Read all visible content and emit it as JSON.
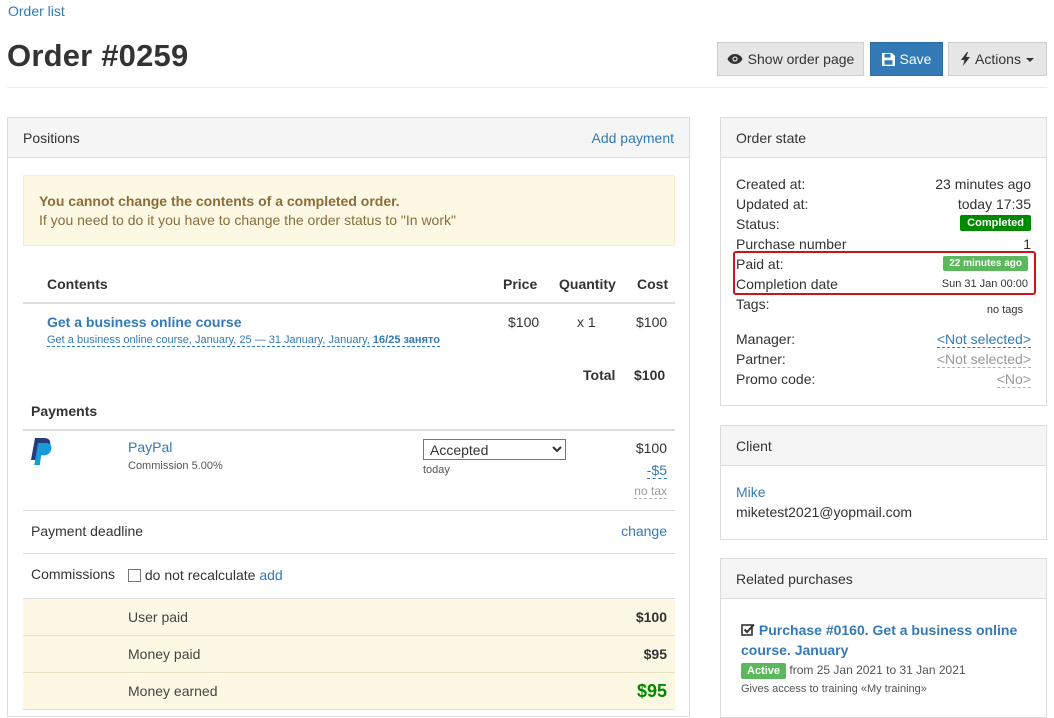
{
  "breadcrumb": {
    "order_list": "Order list"
  },
  "page_title": "Order #0259",
  "toolbar": {
    "show_order_page": "Show order page",
    "save": "Save",
    "actions": "Actions"
  },
  "positions": {
    "title": "Positions",
    "add_payment": "Add payment",
    "warning_title": "You cannot change the contents of a completed order.",
    "warning_text": "If you need to do it you have to change the order status to \"In work\"",
    "headers": {
      "contents": "Contents",
      "price": "Price",
      "quantity": "Quantity",
      "cost": "Cost"
    },
    "item": {
      "name": "Get a business online course",
      "sub": "Get a business online course, January, 25 — 31 January, January, ",
      "seats": "16/25 занято",
      "price": "$100",
      "quantity": "x 1",
      "cost": "$100"
    },
    "total_label": "Total",
    "total_value": "$100",
    "payments_title": "Payments",
    "payment": {
      "method": "PayPal",
      "commission": "Commission 5.00%",
      "status_selected": "Accepted",
      "date": "today",
      "amount": "$100",
      "fee": "-$5",
      "tax": "no tax"
    },
    "deadline_label": "Payment deadline",
    "deadline_action": "change",
    "commissions_label": "Commissions",
    "do_not_recalculate": "do not recalculate",
    "add": "add",
    "summary": [
      {
        "label": "User paid",
        "value": "$100"
      },
      {
        "label": "Money paid",
        "value": "$95"
      },
      {
        "label": "Money earned",
        "value": "$95"
      }
    ]
  },
  "order_state": {
    "title": "Order state",
    "created_label": "Created at:",
    "created_value": "23 minutes ago",
    "updated_label": "Updated at:",
    "updated_value": "today 17:35",
    "status_label": "Status:",
    "status_value": "Completed",
    "purchase_label": "Purchase number",
    "purchase_value": "1",
    "paid_label": "Paid at:",
    "paid_value": "22 minutes ago",
    "completion_label": "Completion date",
    "completion_value": "Sun 31 Jan 00:00",
    "tags_label": "Tags:",
    "tags_value": "no tags",
    "manager_label": "Manager:",
    "manager_value": "<Not selected>",
    "partner_label": "Partner:",
    "partner_value": "<Not selected>",
    "promo_label": "Promo code:",
    "promo_value": "<No>"
  },
  "client": {
    "title": "Client",
    "name": "Mike",
    "email": "miketest2021@yopmail.com"
  },
  "related": {
    "title": "Related purchases",
    "purchase_link": "Purchase #0160. Get a business online course. January",
    "badge": "Active",
    "from_word": "from",
    "date_from": "25 Jan 2021",
    "to_word": "to",
    "date_to": "31 Jan 2021",
    "access": "Gives access to training «My training»"
  },
  "colors": {
    "primary": "#337ab7",
    "success": "#008a00",
    "warning_bg": "#fcf8e3",
    "highlight": "#c9141b",
    "paypal": "#253b80"
  }
}
